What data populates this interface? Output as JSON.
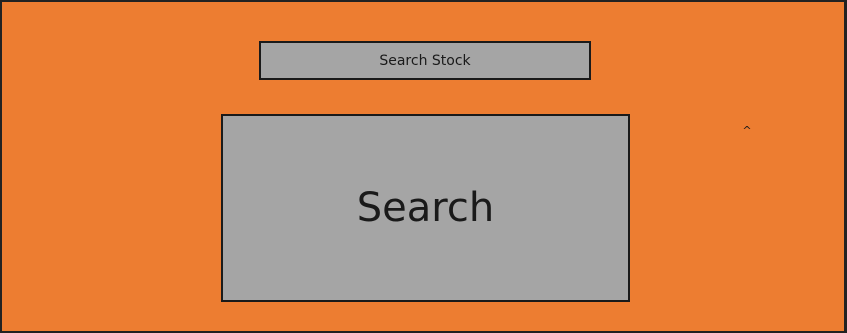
{
  "panel": {
    "background_color": "#ED7D31",
    "search_stock_label": "Search Stock",
    "search_label": "Search",
    "caret_icon": "caret-up-icon",
    "caret_glyph": "^"
  }
}
